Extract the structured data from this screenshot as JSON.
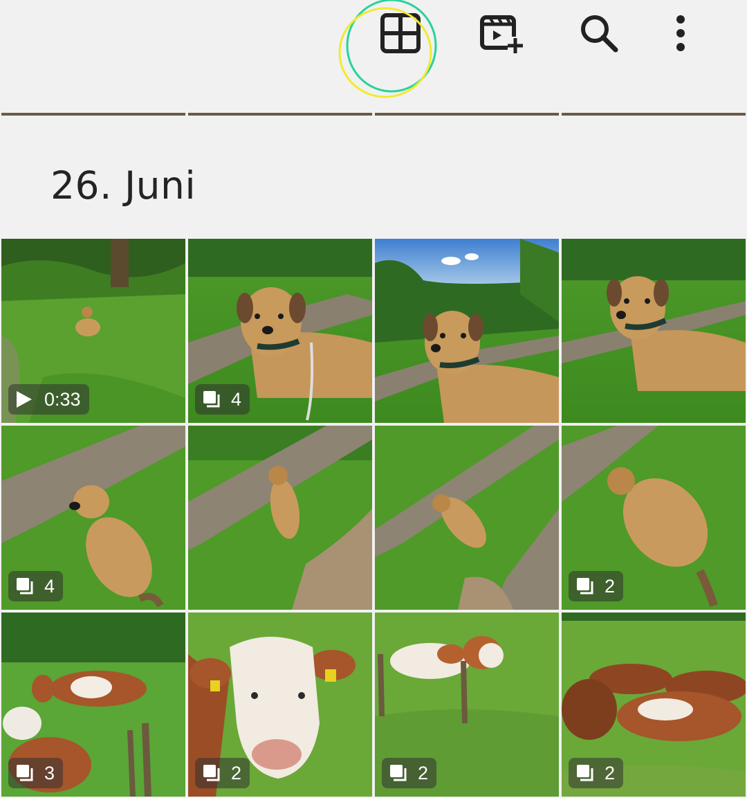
{
  "toolbar": {
    "icons": [
      "grid-view-icon",
      "create-movie-icon",
      "search-icon",
      "more-options-icon"
    ]
  },
  "date_header": "26. Juni",
  "tiles": [
    {
      "scene": "dog-far-video",
      "badge_type": "video",
      "badge_text": "0:33"
    },
    {
      "scene": "dog-close-path",
      "badge_type": "stack",
      "badge_text": "4"
    },
    {
      "scene": "dog-close-sky",
      "badge_type": "none",
      "badge_text": ""
    },
    {
      "scene": "dog-close-grass",
      "badge_type": "none",
      "badge_text": ""
    },
    {
      "scene": "dog-lying-path",
      "badge_type": "stack",
      "badge_text": "4"
    },
    {
      "scene": "dog-small-path",
      "badge_type": "none",
      "badge_text": ""
    },
    {
      "scene": "dog-path-diagonal",
      "badge_type": "none",
      "badge_text": ""
    },
    {
      "scene": "dog-sniffing-grass",
      "badge_type": "stack",
      "badge_text": "2"
    },
    {
      "scene": "cows-pasture",
      "badge_type": "stack",
      "badge_text": "3"
    },
    {
      "scene": "cow-face",
      "badge_type": "stack",
      "badge_text": "2"
    },
    {
      "scene": "cow-lying-fence",
      "badge_type": "stack",
      "badge_text": "2"
    },
    {
      "scene": "cows-herd-lying",
      "badge_type": "stack",
      "badge_text": "2"
    }
  ],
  "colors": {
    "background": "#f1f1f1",
    "icon": "#222222",
    "tap_ring_green": "#27d39a",
    "tap_ring_yellow": "#f1ea2f"
  }
}
